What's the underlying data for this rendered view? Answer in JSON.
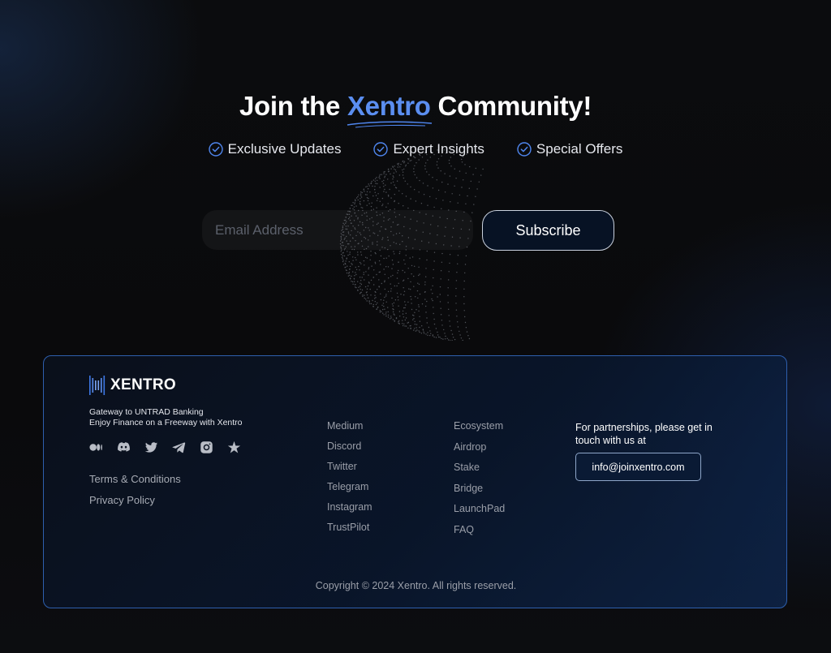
{
  "hero": {
    "title_prefix": "Join the ",
    "title_brand": "Xentro",
    "title_suffix": " Community!",
    "benefits": [
      "Exclusive Updates",
      "Expert Insights",
      "Special Offers"
    ]
  },
  "subscribe": {
    "email_placeholder": "Email Address",
    "email_value": "",
    "button_label": "Subscribe"
  },
  "footer": {
    "logo_text": "XENTRO",
    "tagline_line1": "Gateway to UNTRAD Banking",
    "tagline_line2": "Enjoy Finance on a Freeway with Xentro",
    "socials": [
      "medium-icon",
      "discord-icon",
      "twitter-icon",
      "telegram-icon",
      "instagram-icon",
      "trustpilot-icon"
    ],
    "legal": [
      "Terms & Conditions",
      "Privacy Policy"
    ],
    "community_links": [
      "Medium",
      "Discord",
      "Twitter",
      "Telegram",
      "Instagram",
      "TrustPilot"
    ],
    "product_links": [
      "Ecosystem",
      "Airdrop",
      "Stake",
      "Bridge",
      "LaunchPad",
      "FAQ"
    ],
    "contact_text": "For partnerships, please get in touch with us at",
    "contact_email": "info@joinxentro.com",
    "copyright": "Copyright © 2024 Xentro. All rights reserved."
  },
  "colors": {
    "accent": "#5b8ef0",
    "background": "#0a0b0d",
    "footer_border": "#2e5fae",
    "button_bg": "#071224"
  }
}
